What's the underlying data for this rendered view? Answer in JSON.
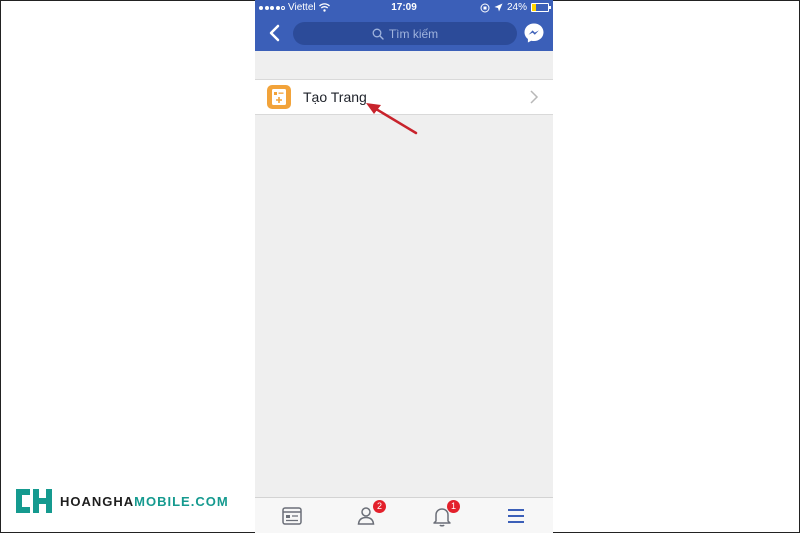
{
  "status_bar": {
    "carrier": "Viettel",
    "time": "17:09",
    "battery": "24%",
    "battery_level": 0.24
  },
  "nav": {
    "search_placeholder": "Tìm kiếm"
  },
  "menu": {
    "create_page_label": "Tạo Trang"
  },
  "tabs": {
    "friends_badge": "2",
    "notifications_badge": "1"
  },
  "watermark": {
    "part1": "HOANGHA",
    "part2": "MOBILE.COM"
  },
  "colors": {
    "facebook_blue": "#3b5fb8",
    "badge_red": "#e3202b",
    "annotation_arrow": "#c8232c",
    "page_icon_orange": "#f2a33a"
  }
}
